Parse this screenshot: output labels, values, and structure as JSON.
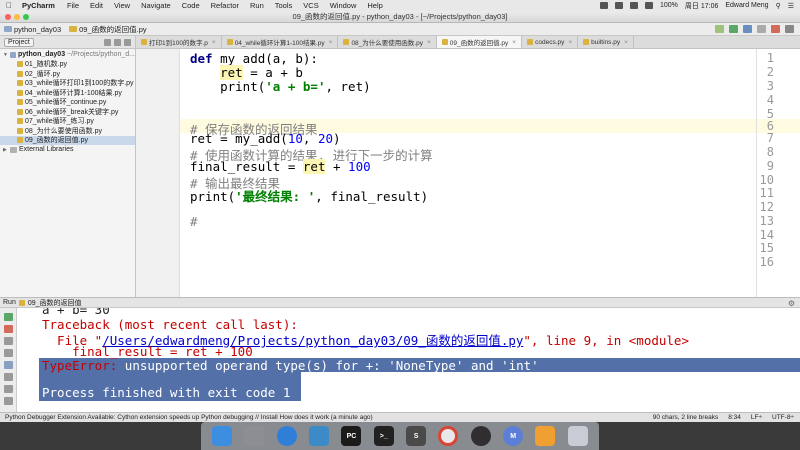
{
  "menubar": {
    "app": "PyCharm",
    "items": [
      "File",
      "Edit",
      "View",
      "Navigate",
      "Code",
      "Refactor",
      "Run",
      "Tools",
      "VCS",
      "Window",
      "Help"
    ],
    "battery": "100%",
    "clock": "周日 17:06",
    "user": "Edward Meng"
  },
  "window": {
    "title": "09_函数的返回值.py - python_day03 - [~/Projects/python_day03]"
  },
  "navbar": {
    "crumbs": [
      "python_day03",
      "09_函数的返回值.py"
    ]
  },
  "project_panel": {
    "selector": "Project",
    "root": "python_day03",
    "root_path": "~/Projects/python_d...",
    "files": [
      "01_随机数.py",
      "02_循环.py",
      "03_while循环打印1到100的数字.py",
      "04_while循环计算1-100结果.py",
      "05_while循环_continue.py",
      "06_while循环_break关键字.py",
      "07_while循环_练习.py",
      "08_为什么要使用函数.py",
      "09_函数的返回值.py"
    ],
    "external": "External Libraries"
  },
  "tabs": [
    {
      "label": "打印1到100的数字.p"
    },
    {
      "label": "04_while循环计算1-100结果.py"
    },
    {
      "label": "08_为什么要使用函数.py"
    },
    {
      "label": "09_函数的返回值.py"
    },
    {
      "label": "codecs.py"
    },
    {
      "label": "builtins.py"
    }
  ],
  "editor": {
    "line_numbers": [
      "1",
      "2",
      "3",
      "4",
      "5",
      "6",
      "7",
      "8",
      "9",
      "10",
      "11",
      "12",
      "13",
      "14",
      "15",
      "16"
    ],
    "line1_kw": "def",
    "line1_rest": " my_add(a, b):",
    "line2_pre": "    ",
    "line2_hl": "ret",
    "line2_rest": " = a + b",
    "line3_pre": "    print(",
    "line3_str": "'a + b='",
    "line3_rest": ", ret)",
    "line6": "# 保存函数的返回结果",
    "line7_pre": "ret = my_add(",
    "line7_n1": "10",
    "line7_mid": ", ",
    "line7_n2": "20",
    "line7_end": ")",
    "line8": "# 使用函数计算的结果, 进行下一步的计算",
    "line9_pre": "final_result = ",
    "line9_hl": "ret",
    "line9_mid": " + ",
    "line9_num": "100",
    "line10": "# 输出最终结果",
    "line11_pre": "print(",
    "line11_str": "'最终结果: '",
    "line11_rest": ", final_result)",
    "line13": "#"
  },
  "run": {
    "header": "Run",
    "config": "09_函数的返回值",
    "line0": "a + b= 30",
    "line1": "Traceback (most recent call last):",
    "line2_pre": "  File \"",
    "line2_link": "/Users/edwardmeng/Projects/python_day03/09_函数的返回值.py",
    "line2_rest": "\", line 9, in <module>",
    "line3": "    final_result = ret + 100",
    "line4_a": "TypeError: ",
    "line4_b": "unsupported operand type(s) for +: 'NoneType' and 'int'",
    "line5": "Process finished with exit code 1"
  },
  "status": {
    "message": "Python Debugger Extension Available: Cython extension speeds up Python debugging // Install How does it work (a minute ago)",
    "chars": "90 chars, 2 line breaks",
    "pos": "8:34",
    "lf": "LF÷",
    "enc": "UTF-8÷"
  },
  "dock": [
    "Finder",
    "Launchpad",
    "Safari",
    "Preview",
    "PyCharm",
    "Terminal",
    "Sublime Text",
    "Chrome",
    "OBS",
    "MindNode",
    "Pages",
    "Trash"
  ]
}
